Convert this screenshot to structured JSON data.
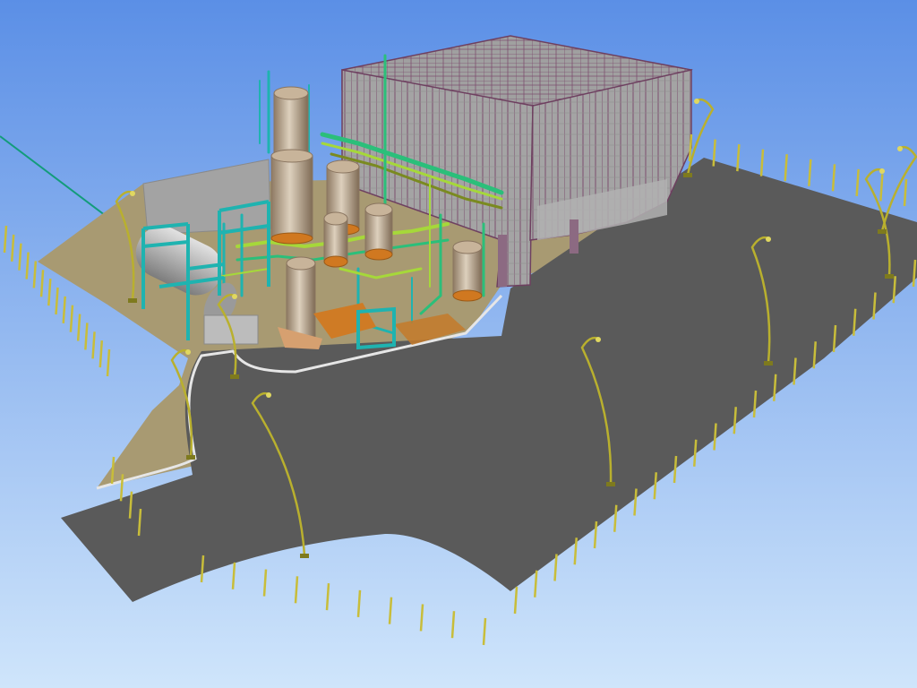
{
  "scene": {
    "subject": "3D plant model",
    "colors": {
      "sky_top": "#5b8fe6",
      "sky_bottom": "#cfe5fb",
      "asphalt": "#5a5a5a",
      "ground_pad": "#a89a72",
      "curb": "#e6e6e6",
      "vessel_fill": "#c8b49a",
      "vessel_edge": "#8a7560",
      "pipe_green": "#2bbf7a",
      "pipe_teal": "#1fb3b0",
      "pipe_lime": "#a6d83a",
      "pipe_olive": "#7a8a20",
      "steel_frame": "#8a5a7a",
      "building_wall": "#9a9a9a",
      "orange_base": "#d07820",
      "lamp_pole": "#b9b02e",
      "fence_post": "#c8bd3a",
      "tank_grey": "#b8b8b8"
    },
    "icons": [
      "street-lamp-icon",
      "fence-post-icon",
      "vessel-icon",
      "steel-frame-icon"
    ]
  }
}
